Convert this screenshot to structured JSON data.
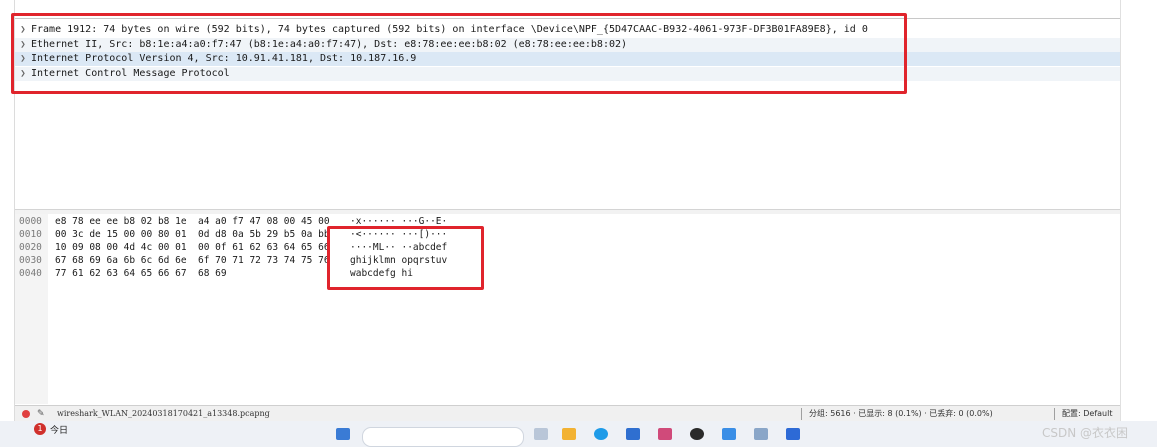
{
  "packet_details": [
    {
      "label": "Frame 1912: 74 bytes on wire (592 bits), 74 bytes captured (592 bits) on interface \\Device\\NPF_{5D47CAAC-B932-4061-973F-DF3B01FA89E8}, id 0"
    },
    {
      "label": "Ethernet II, Src: b8:1e:a4:a0:f7:47 (b8:1e:a4:a0:f7:47), Dst: e8:78:ee:ee:b8:02 (e8:78:ee:ee:b8:02)"
    },
    {
      "label": "Internet Protocol Version 4, Src: 10.91.41.181, Dst: 10.187.16.9"
    },
    {
      "label": "Internet Control Message Protocol"
    }
  ],
  "packet_bytes": [
    {
      "offset": "0000",
      "hex": "e8 78 ee ee b8 02 b8 1e  a4 a0 f7 47 08 00 45 00",
      "ascii": "·x······ ···G··E·"
    },
    {
      "offset": "0010",
      "hex": "00 3c de 15 00 00 80 01  0d d8 0a 5b 29 b5 0a bb",
      "ascii": "·<······ ···[)···"
    },
    {
      "offset": "0020",
      "hex": "10 09 08 00 4d 4c 00 01  00 0f 61 62 63 64 65 66",
      "ascii": "····ML·· ··abcdef"
    },
    {
      "offset": "0030",
      "hex": "67 68 69 6a 6b 6c 6d 6e  6f 70 71 72 73 74 75 76",
      "ascii": "ghijklmn opqrstuv"
    },
    {
      "offset": "0040",
      "hex": "77 61 62 63 64 65 66 67  68 69",
      "ascii": "wabcdefg hi"
    }
  ],
  "statusbar": {
    "file": "wireshark_WLAN_20240318170421_a13348.pcapng",
    "stats": "分组: 5616 · 已显示: 8 (0.1%) · 已丢弃: 0 (0.0%)",
    "profile": "配置: Default"
  },
  "taskbar": {
    "badge": "1",
    "label": "今日"
  },
  "watermark": "CSDN @衣衣困",
  "colors": {
    "highlight": "#e0242c",
    "selected_row": "#dbe8f5"
  }
}
